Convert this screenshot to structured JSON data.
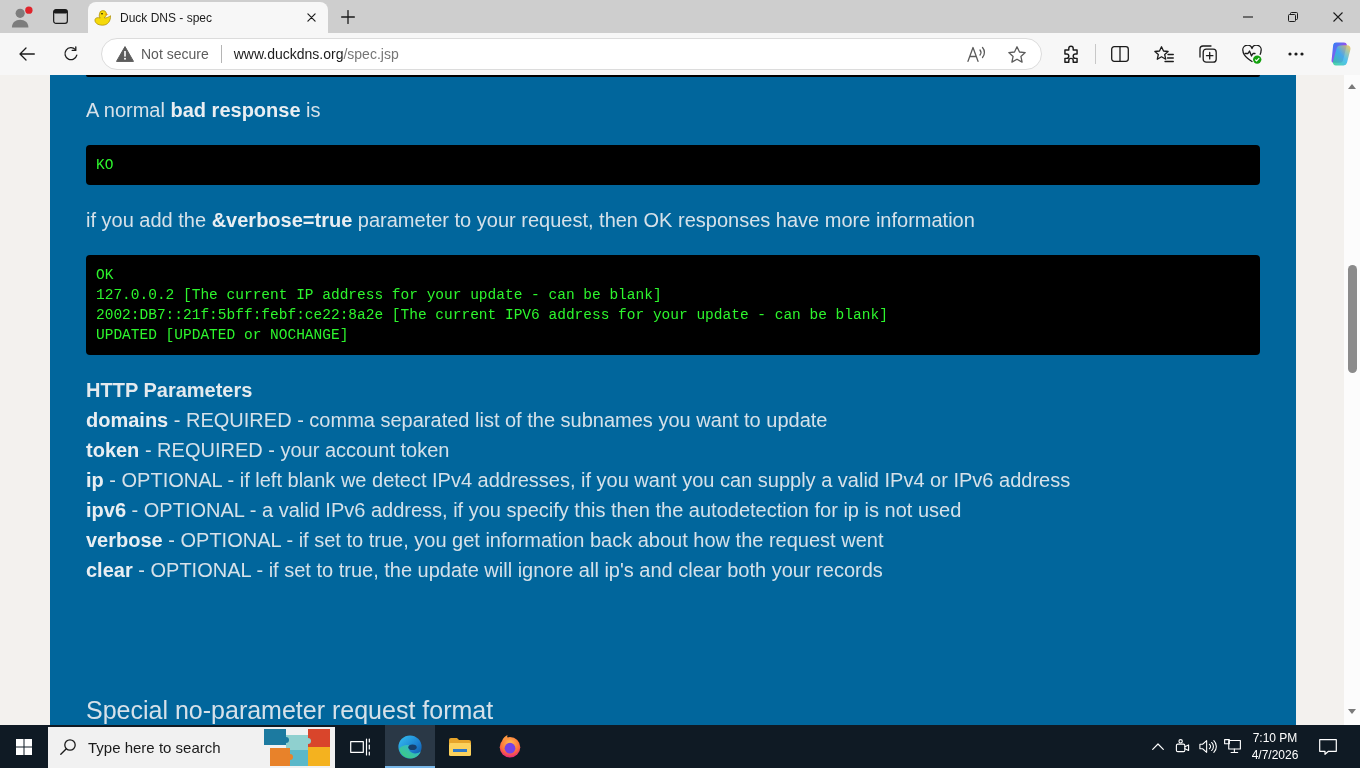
{
  "browser": {
    "tabs": [
      {
        "title": "Duck DNS - spec",
        "selected": true
      }
    ],
    "address_bar": {
      "security": "Not secure",
      "host": "www.duckdns.org",
      "path": "/spec.jsp"
    }
  },
  "page": {
    "blocks": [
      {
        "kind": "code_end"
      },
      {
        "kind": "paragraph",
        "text": "A normal **bad response** is"
      },
      {
        "kind": "code",
        "lines": [
          "KO"
        ]
      },
      {
        "kind": "paragraph",
        "text": "if you add the **&verbose=true** parameter to your request, then OK responses have more information"
      },
      {
        "kind": "code",
        "lines": [
          "OK",
          "127.0.0.2 [The current IP address for your update - can be blank]",
          "2002:DB7::21f:5bff:febf:ce22:8a2e [The current IPV6 address for your update - can be blank]",
          "UPDATED [UPDATED or NOCHANGE]"
        ]
      },
      {
        "kind": "subheading",
        "text": "HTTP Parameters"
      },
      {
        "kind": "line",
        "text": "**domains** - REQUIRED - comma separated list of the subnames you want to update"
      },
      {
        "kind": "line",
        "text": "**token** - REQUIRED - your account token"
      },
      {
        "kind": "line",
        "text": "**ip** - OPTIONAL - if left blank we detect IPv4 addresses, if you want you can supply a valid IPv4 or IPv6 address"
      },
      {
        "kind": "line",
        "text": "**ipv6** - OPTIONAL - a valid IPv6 address, if you specify this then the autodetection for ip is not used"
      },
      {
        "kind": "line",
        "text": "**verbose** - OPTIONAL - if set to true, you get information back about how the request went"
      },
      {
        "kind": "line",
        "text": "**clear** - OPTIONAL - if set to true, the update will ignore all ip's and clear both your records"
      },
      {
        "kind": "heading",
        "text": "Special no-parameter request format"
      }
    ]
  },
  "taskbar": {
    "search": {
      "placeholder": "Type here to search"
    },
    "apps": [
      {
        "kind": "task_view",
        "selected": false
      },
      {
        "kind": "edge",
        "selected": true
      },
      {
        "kind": "explorer",
        "selected": false
      },
      {
        "kind": "firefox",
        "selected": false
      }
    ],
    "clock": {
      "time": "7:10 PM",
      "date": "4/7/2026"
    }
  }
}
